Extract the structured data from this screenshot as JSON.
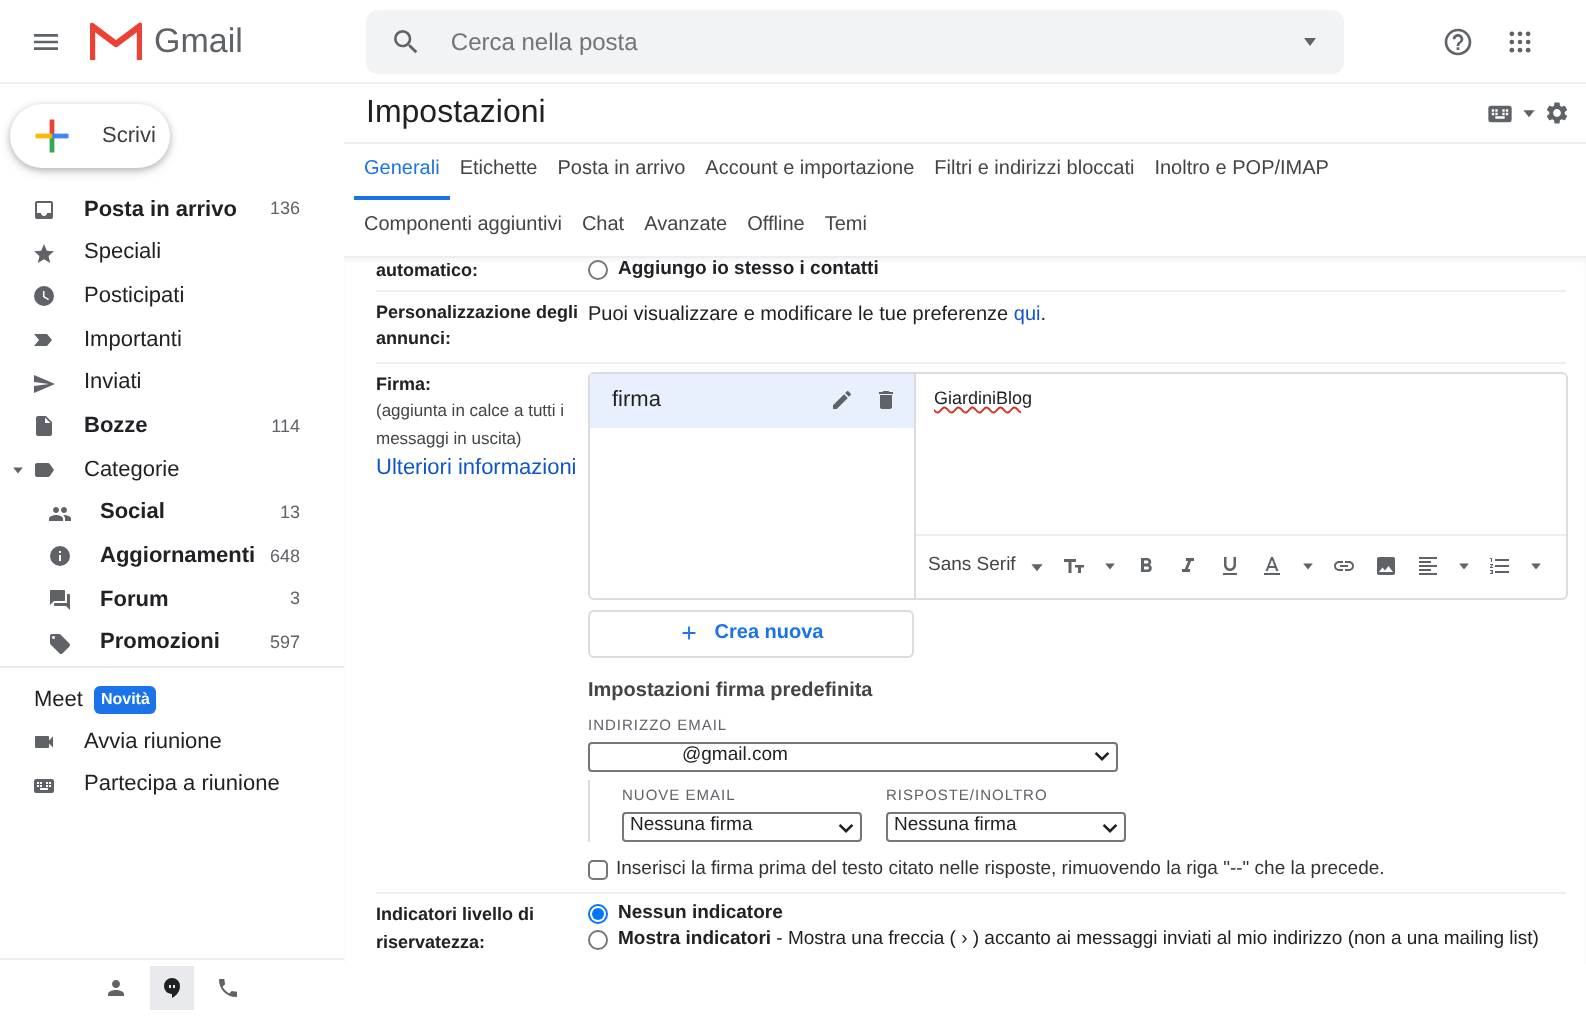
{
  "header": {
    "app_name": "Gmail",
    "search": {
      "placeholder": "Cerca nella posta"
    }
  },
  "compose": {
    "label": "Scrivi"
  },
  "sidebar": {
    "items": [
      {
        "label": "Posta in arrivo",
        "count": "136",
        "unread": true
      },
      {
        "label": "Speciali",
        "unread": false
      },
      {
        "label": "Posticipati",
        "unread": false
      },
      {
        "label": "Importanti",
        "unread": false
      },
      {
        "label": "Inviati",
        "unread": false
      },
      {
        "label": "Bozze",
        "count": "114",
        "unread": true
      },
      {
        "label": "Categorie",
        "unread": false,
        "expanded": true,
        "children": [
          {
            "label": "Social",
            "count": "13",
            "unread": true
          },
          {
            "label": "Aggiornamenti",
            "count": "648",
            "unread": true
          },
          {
            "label": "Forum",
            "count": "3",
            "unread": true
          },
          {
            "label": "Promozioni",
            "count": "597",
            "unread": true
          }
        ]
      }
    ]
  },
  "meet": {
    "title": "Meet",
    "badge": "Novità",
    "items": [
      "Avvia riunione",
      "Partecipa a riunione"
    ]
  },
  "footer_tabs": [
    {
      "selected": false
    },
    {
      "selected": true
    },
    {
      "selected": false
    }
  ],
  "settings": {
    "title": "Impostazioni",
    "tabs": [
      [
        {
          "label": "Generali",
          "selected": true
        },
        {
          "label": "Etichette",
          "selected": false
        },
        {
          "label": "Posta in arrivo",
          "selected": false
        },
        {
          "label": "Account e importazione",
          "selected": false
        },
        {
          "label": "Filtri e indirizzi bloccati",
          "selected": false
        },
        {
          "label": "Inoltro e POP/IMAP",
          "selected": false
        }
      ],
      [
        {
          "label": "Componenti aggiuntivi",
          "selected": false
        },
        {
          "label": "Chat",
          "selected": false
        },
        {
          "label": "Avanzate",
          "selected": false
        },
        {
          "label": "Offline",
          "selected": false
        },
        {
          "label": "Temi",
          "selected": false
        }
      ]
    ],
    "rows": [
      {
        "kind": "radio",
        "label": "automatico:",
        "options": [
          {
            "label": "Aggiungo io stesso i contatti",
            "selected": false
          }
        ]
      },
      {
        "kind": "text",
        "label": "Personalizzazione degli annunci:",
        "text": "Puoi visualizzare e modificare le tue preferenze",
        "link": "qui",
        "after": "."
      },
      {
        "kind": "signature",
        "label": "Firma:",
        "note": "(aggiunta in calce a tutti i messaggi in uscita)",
        "link": "Ulteriori informazioni",
        "signatures": [
          {
            "name": "firma",
            "selected": true
          }
        ],
        "editor_text": "GiardiniBlog",
        "font": "Sans Serif",
        "create_button": "Crea nuova",
        "defaults": {
          "title": "Impostazioni firma predefinita",
          "email_label": "INDIRIZZO EMAIL",
          "email_value": "@gmail.com",
          "new_label": "NUOVE EMAIL",
          "new_value": "Nessuna firma",
          "reply_label": "RISPOSTE/INOLTRO",
          "reply_value": "Nessuna firma"
        },
        "checkbox": {
          "label": "Inserisci la firma prima del testo citato nelle risposte, rimuovendo la riga \"--\" che la precede.",
          "checked": false
        }
      },
      {
        "kind": "radio",
        "label": "Indicatori livello di riservatezza:",
        "options": [
          {
            "label": "Nessun indicatore",
            "selected": true
          },
          {
            "label": "**Mostra indicatori** - Mostra una freccia ( › ) accanto ai messaggi inviati al mio indirizzo (non a una mailing list)",
            "selected": false
          }
        ]
      }
    ]
  }
}
